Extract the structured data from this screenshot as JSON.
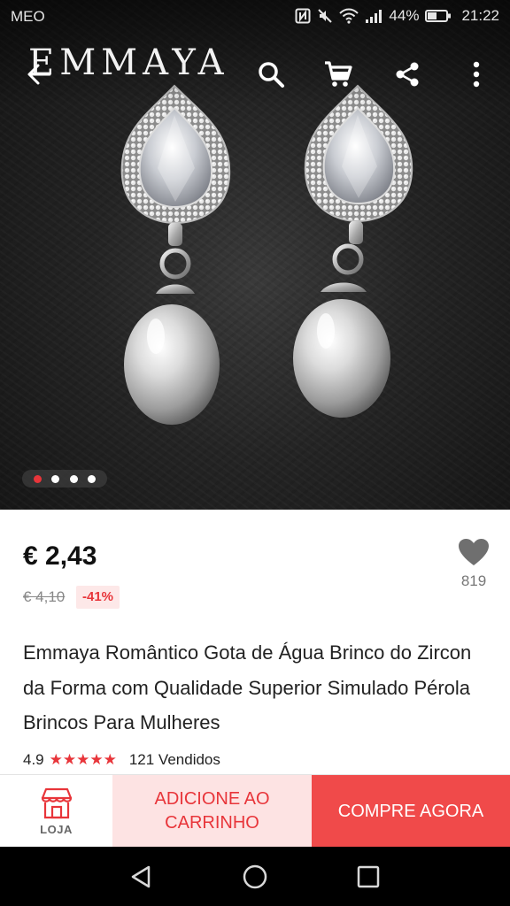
{
  "status_bar": {
    "carrier": "MEO",
    "battery": "44%",
    "time": "21:22"
  },
  "app_bar": {
    "brand": "EMMAYA",
    "icons": [
      "back-arrow-icon",
      "search-icon",
      "cart-icon",
      "share-icon",
      "more-icon"
    ]
  },
  "gallery": {
    "image_count": 4,
    "active_index": 0
  },
  "product": {
    "price": "€ 2,43",
    "original_price": "€ 4,10",
    "discount": "-41%",
    "wishlist_count": "819",
    "title": "Emmaya Romântico Gota de Água Brinco do Zircon da Forma com Qualidade Superior Simulado Pérola Brincos Para Mulheres",
    "rating": "4.9",
    "stars": "★★★★★",
    "sold": "121 Vendidos"
  },
  "actions": {
    "store_label": "LOJA",
    "add_to_cart": "ADICIONE AO CARRINHO",
    "buy_now": "COMPRE AGORA"
  },
  "colors": {
    "accent": "#e8353a",
    "buy_now_bg": "#f04a4a",
    "add_cart_bg": "#fde3e3"
  }
}
